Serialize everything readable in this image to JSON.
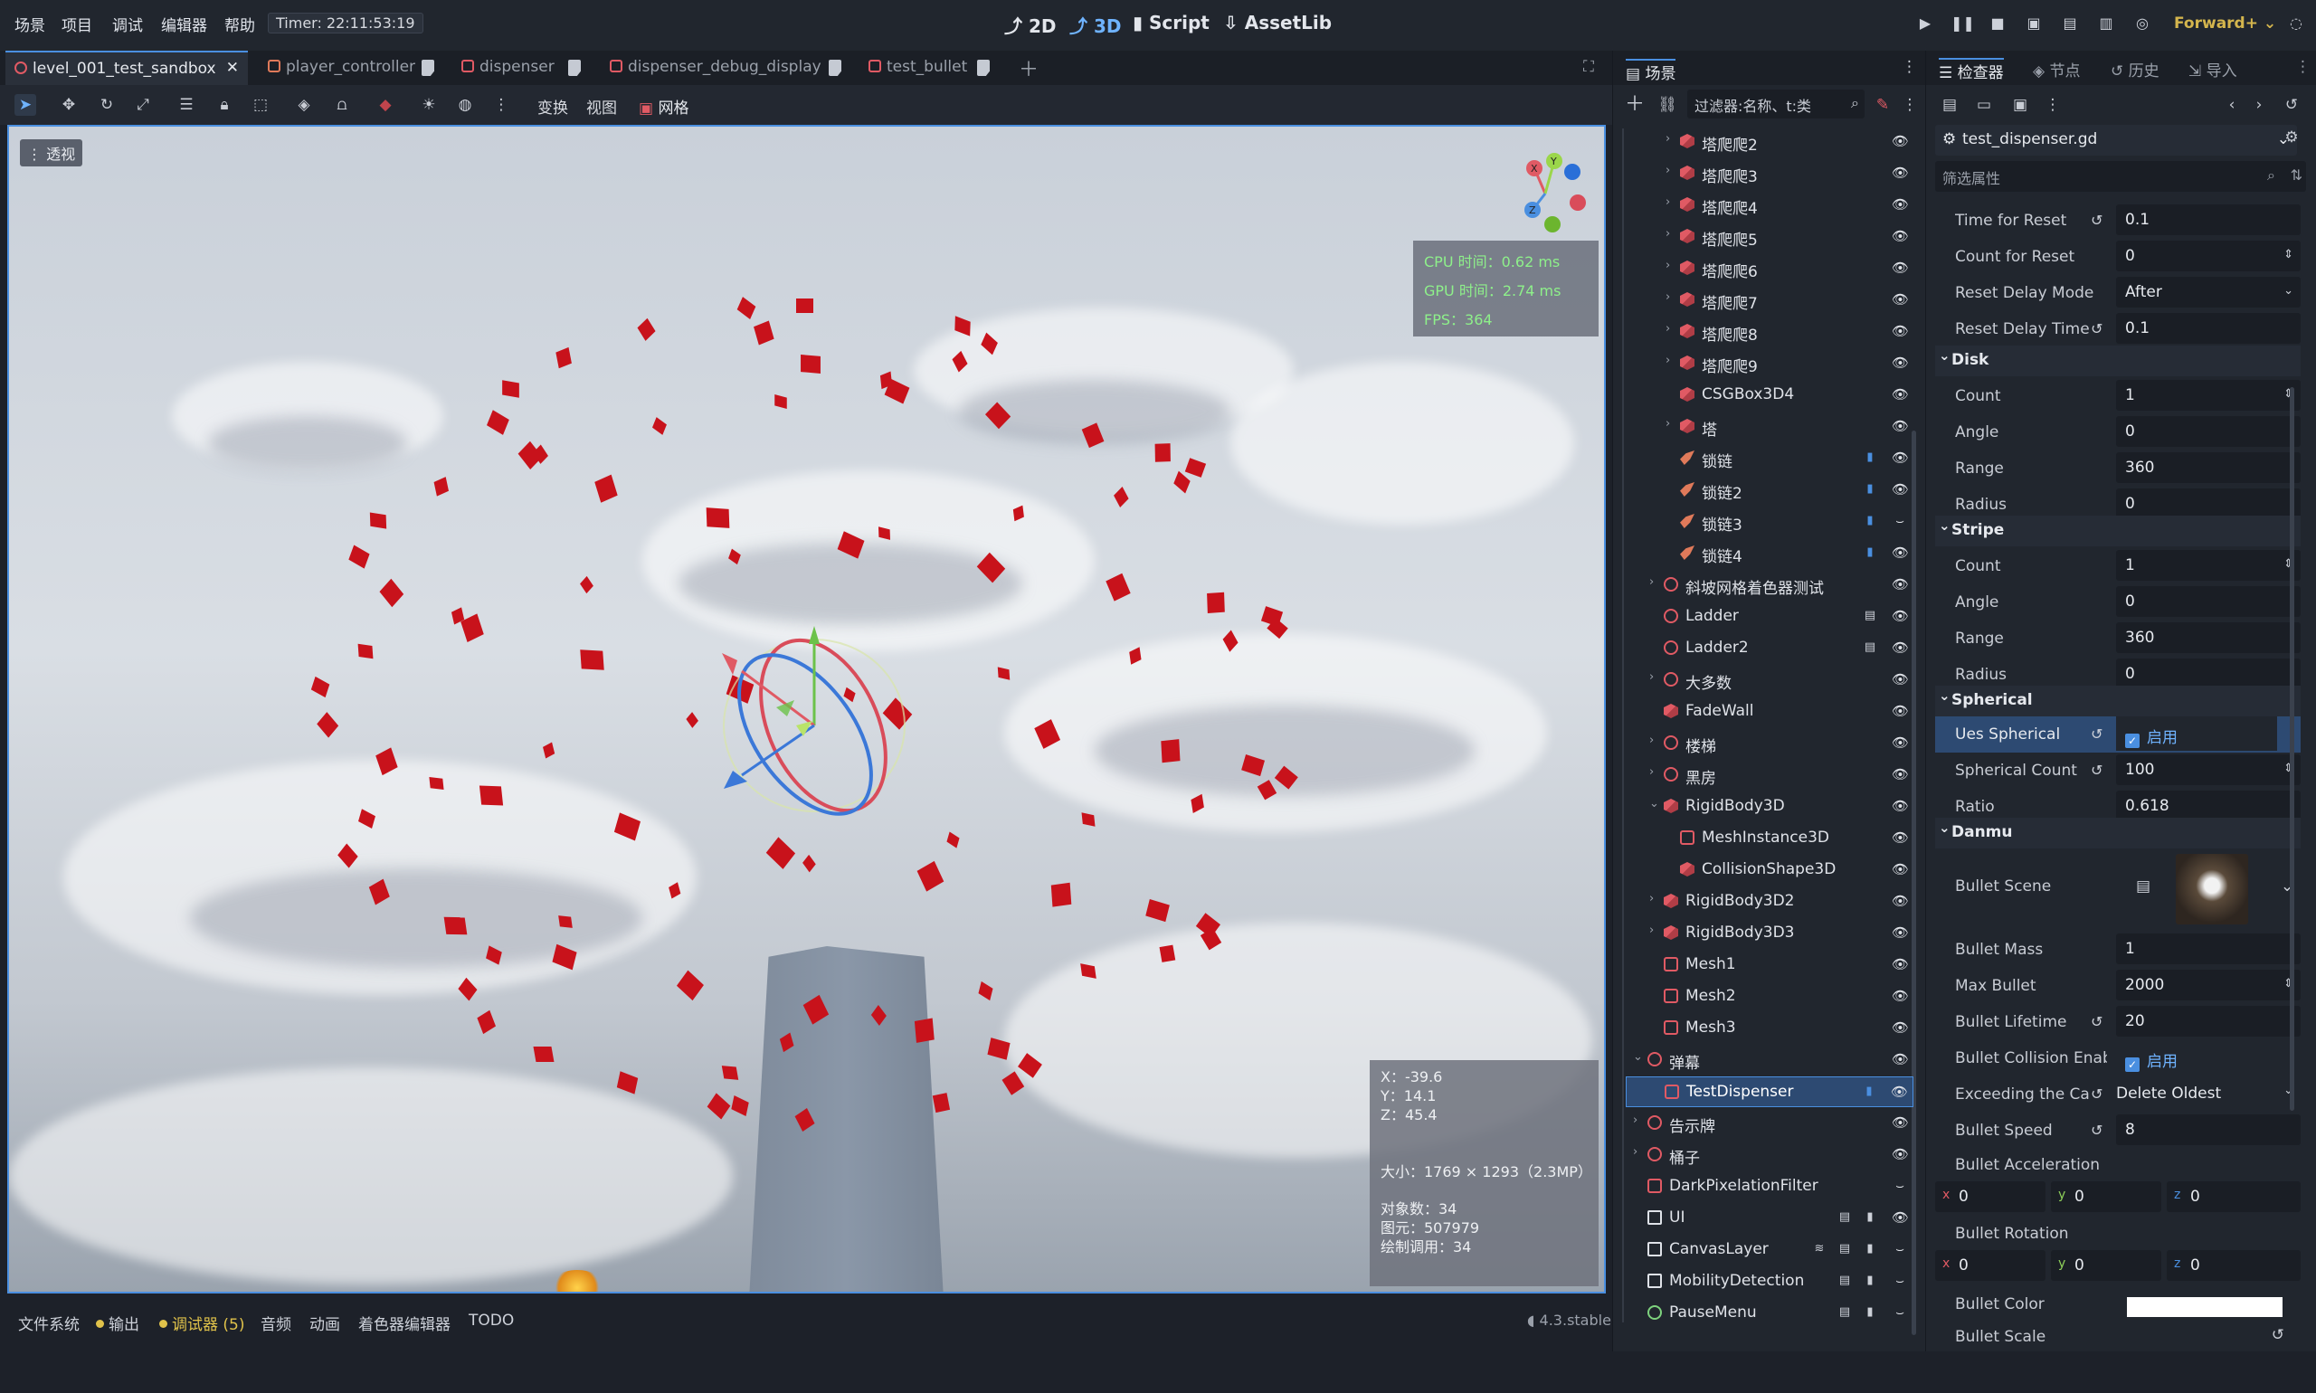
{
  "menu": [
    "场景",
    "项目",
    "调试",
    "编辑器",
    "帮助"
  ],
  "timer": "Timer: 22:11:53:19",
  "modes": {
    "m2d": "2D",
    "m3d": "3D",
    "script": "Script",
    "assetlib": "AssetLib"
  },
  "renderer": "Forward+",
  "tabs": [
    "level_001_test_sandbox",
    "player_controller",
    "dispenser",
    "dispenser_debug_display",
    "test_bullet"
  ],
  "viewport_menus": {
    "transform": "变换",
    "view": "视图",
    "grid": "网格"
  },
  "viewport": {
    "perspective": "透视",
    "stats": {
      "cpu": "CPU 时间：0.62 ms",
      "gpu": "GPU 时间：2.74 ms",
      "fps": "FPS：364"
    },
    "coords": {
      "x": "X：-39.6",
      "y": "Y：14.1",
      "z": "Z：45.4",
      "size": "大小：1769 × 1293（2.3MP）",
      "objects": "对象数：34",
      "primitives": "图元：507979",
      "drawcalls": "绘制调用：34"
    },
    "axis_labels": {
      "x": "X",
      "y": "Y",
      "z": "Z"
    }
  },
  "bottom_tabs": {
    "fs": "文件系统",
    "output": "输出",
    "debugger": "调试器 (5)",
    "audio": "音频",
    "anim": "动画",
    "shader": "着色器编辑器",
    "todo": "TODO"
  },
  "version": "4.3.stable",
  "scene_dock": {
    "title": "场景",
    "filter": "过滤器:名称、t:类",
    "nodes": [
      {
        "label": "塔爬爬2"
      },
      {
        "label": "塔爬爬3"
      },
      {
        "label": "塔爬爬4"
      },
      {
        "label": "塔爬爬5"
      },
      {
        "label": "塔爬爬6"
      },
      {
        "label": "塔爬爬7"
      },
      {
        "label": "塔爬爬8"
      },
      {
        "label": "塔爬爬9"
      },
      {
        "label": "CSGBox3D4"
      },
      {
        "label": "塔"
      },
      {
        "label": "锁链"
      },
      {
        "label": "锁链2"
      },
      {
        "label": "锁链3"
      },
      {
        "label": "锁链4"
      },
      {
        "label": "斜坡网格着色器测试"
      },
      {
        "label": "Ladder"
      },
      {
        "label": "Ladder2"
      },
      {
        "label": "大多数"
      },
      {
        "label": "FadeWall"
      },
      {
        "label": "楼梯"
      },
      {
        "label": "黑房"
      },
      {
        "label": "RigidBody3D"
      },
      {
        "label": "MeshInstance3D"
      },
      {
        "label": "CollisionShape3D"
      },
      {
        "label": "RigidBody3D2"
      },
      {
        "label": "RigidBody3D3"
      },
      {
        "label": "Mesh1"
      },
      {
        "label": "Mesh2"
      },
      {
        "label": "Mesh3"
      },
      {
        "label": "弹幕"
      },
      {
        "label": "TestDispenser"
      },
      {
        "label": "告示牌"
      },
      {
        "label": "桶子"
      },
      {
        "label": "DarkPixelationFilter"
      },
      {
        "label": "UI"
      },
      {
        "label": "CanvasLayer"
      },
      {
        "label": "MobilityDetection"
      },
      {
        "label": "PauseMenu"
      }
    ]
  },
  "inspector": {
    "tabs": {
      "inspector": "检查器",
      "node": "节点",
      "history": "历史",
      "import": "导入"
    },
    "resource": "test_dispenser.gd",
    "filter_placeholder": "筛选属性",
    "props": {
      "time_for_reset": {
        "name": "Time for Reset",
        "value": "0.1"
      },
      "count_for_reset": {
        "name": "Count for Reset",
        "value": "0"
      },
      "reset_delay_mode": {
        "name": "Reset Delay Mode",
        "value": "After"
      },
      "reset_delay_time": {
        "name": "Reset Delay Time",
        "value": "0.1"
      },
      "disk": {
        "title": "Disk",
        "count": "1",
        "angle": "0",
        "range": "360",
        "radius": "0"
      },
      "stripe": {
        "title": "Stripe",
        "count": "1",
        "angle": "0",
        "range": "360",
        "radius": "0"
      },
      "labels": {
        "count": "Count",
        "angle": "Angle",
        "range": "Range",
        "radius": "Radius"
      },
      "spherical": {
        "title": "Spherical",
        "ues_name": "Ues Spherical",
        "ues_value": "启用",
        "count_name": "Spherical Count",
        "count_value": "100",
        "ratio_name": "Ratio",
        "ratio_value": "0.618"
      },
      "danmu": {
        "title": "Danmu"
      },
      "bullet_scene": {
        "name": "Bullet Scene"
      },
      "bullet_mass": {
        "name": "Bullet Mass",
        "value": "1"
      },
      "max_bullet": {
        "name": "Max Bullet",
        "value": "2000"
      },
      "bullet_lifetime": {
        "name": "Bullet Lifetime",
        "value": "20"
      },
      "bullet_collision": {
        "name": "Bullet Collision Enabl",
        "value": "启用"
      },
      "exceeding": {
        "name": "Exceeding the Ca",
        "value": "Delete Oldest"
      },
      "bullet_speed": {
        "name": "Bullet Speed",
        "value": "8"
      },
      "bullet_accel": {
        "name": "Bullet Acceleration",
        "x": "0",
        "y": "0",
        "z": "0"
      },
      "bullet_rotation": {
        "name": "Bullet Rotation",
        "x": "0",
        "y": "0",
        "z": "0"
      },
      "bullet_color": {
        "name": "Bullet Color",
        "value": "#ffffff"
      },
      "bullet_scale": {
        "name": "Bullet Scale"
      },
      "vec_axes": {
        "x": "x",
        "y": "y",
        "z": "z"
      }
    }
  },
  "colors": {
    "accent": "#4a8fe0",
    "bullet": "#c8121b",
    "node_icon": "#e05a64",
    "fps_green": "#8ef08a",
    "renderer_gold": "#d4b54d"
  }
}
